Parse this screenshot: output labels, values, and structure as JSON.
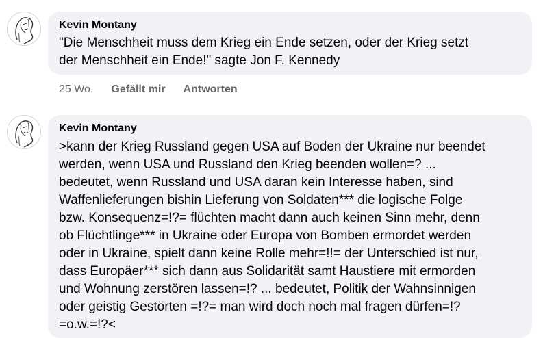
{
  "comments": [
    {
      "author": "Kevin Montany",
      "text": "\"Die Menschheit muss dem Krieg ein Ende setzen, oder der Krieg setzt\nder Menschheit ein Ende!\" sagte Jon F. Kennedy",
      "time": "25 Wo.",
      "like_label": "Gefällt mir",
      "reply_label": "Antworten"
    },
    {
      "author": "Kevin Montany",
      "text": ">kann der Krieg Russland gegen USA auf Boden der Ukraine nur beendet\nwerden, wenn USA und Russland den Krieg beenden wollen=? ...\nbedeutet, wenn Russland und USA daran kein Interesse haben, sind\nWaffenlieferungen bishin Lieferung von Soldaten*** die logische Folge\nbzw. Konsequenz=!?= flüchten macht dann auch keinen Sinn mehr, denn\nob Flüchtlinge*** in Ukraine oder Europa von Bomben ermordet werden\noder in Ukraine, spielt dann keine Rolle mehr=!!= der Unterschied ist nur,\ndass Europäer*** sich dann aus Solidarität samt Haustiere mit ermorden\nund Wohnung zerstören  lassen=!? ... bedeutet, Politik der Wahnsinnigen\noder geistig Gestörten =!?=  man wird doch noch mal fragen dürfen=!?\n=o.w.=!?<"
    }
  ],
  "avatar_icon": "sketch-face-avatar-icon"
}
